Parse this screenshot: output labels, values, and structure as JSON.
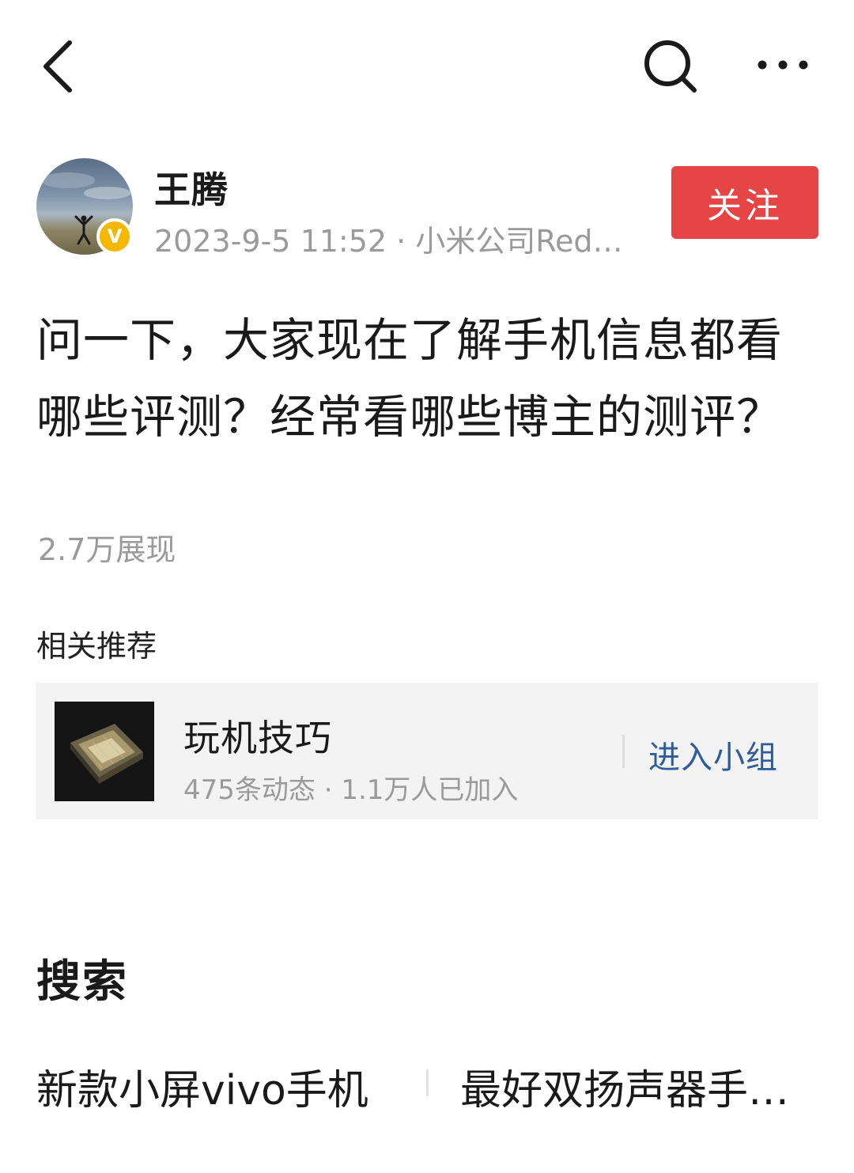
{
  "header": {
    "back_icon": "back-chevron-icon",
    "search_icon": "search-icon",
    "more_icon": "more-dots-icon"
  },
  "author": {
    "name": "王腾",
    "meta": "2023-9-5 11:52 · 小米公司Red…",
    "verified_badge": "V",
    "follow_label": "关注"
  },
  "post": {
    "text": "问一下，大家现在了解手机信息都看哪些评测？经常看哪些博主的测评？",
    "impressions": "2.7万展现"
  },
  "related": {
    "title": "相关推荐",
    "group": {
      "name": "玩机技巧",
      "stats": "475条动态 · 1.1万人已加入",
      "join_label": "进入小组"
    }
  },
  "search": {
    "heading": "搜索",
    "suggestions": [
      "新款小屏vivo手机",
      "最好双扬声器手…"
    ]
  },
  "colors": {
    "follow_button": "#e64545",
    "link": "#2e5c99",
    "muted_text": "#9a9a9a",
    "card_background": "#f3f3f3",
    "verified_badge": "#f5b800"
  }
}
